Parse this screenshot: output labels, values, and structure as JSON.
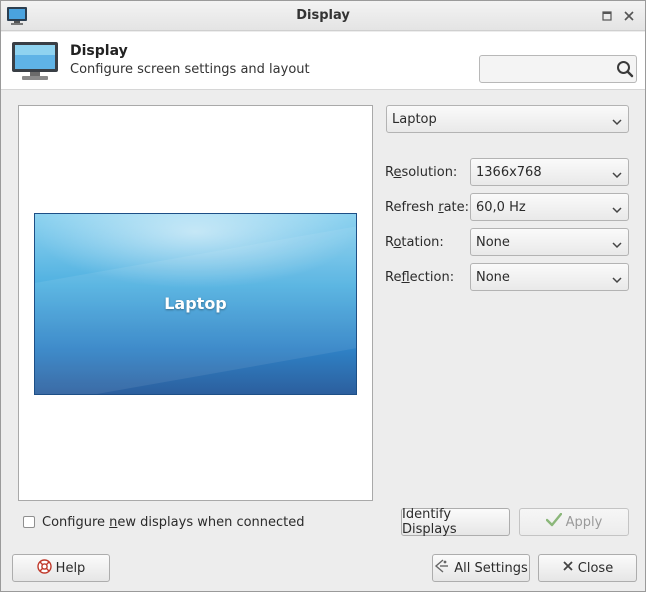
{
  "window": {
    "title": "Display",
    "icons": {
      "app": "monitor-icon",
      "maximize": "maximize-icon",
      "close": "close-icon"
    }
  },
  "header": {
    "title": "Display",
    "subtitle": "Configure screen settings and layout",
    "icon": "display-monitor-icon",
    "search": {
      "value": "",
      "placeholder": "",
      "icon": "search-icon"
    }
  },
  "preview": {
    "monitor_label": "Laptop"
  },
  "output_select": {
    "value": "Laptop"
  },
  "settings": {
    "resolution": {
      "label_pre": "R",
      "label_ul": "e",
      "label_post": "solution:",
      "value": "1366x768"
    },
    "refresh": {
      "label_pre": "Refresh ",
      "label_ul": "r",
      "label_post": "ate:",
      "value": "60,0 Hz"
    },
    "rotation": {
      "label_pre": "R",
      "label_ul": "o",
      "label_post": "tation:",
      "value": "None"
    },
    "reflection": {
      "label_pre": "Re",
      "label_ul": "f",
      "label_post": "lection:",
      "value": "None"
    }
  },
  "options": {
    "configure_new": {
      "label_pre": "Configure ",
      "label_ul": "n",
      "label_post": "ew displays when connected",
      "checked": false
    }
  },
  "buttons": {
    "identify": "Identify Displays",
    "apply": "Apply",
    "help": "Help",
    "all_settings": "All Settings",
    "close": "Close"
  },
  "colors": {
    "accent_monitor_top": "#8fd3f0",
    "accent_monitor_bottom": "#2c5f9e",
    "apply_check": "#6aa84f",
    "help_icon": "#c0392b"
  }
}
